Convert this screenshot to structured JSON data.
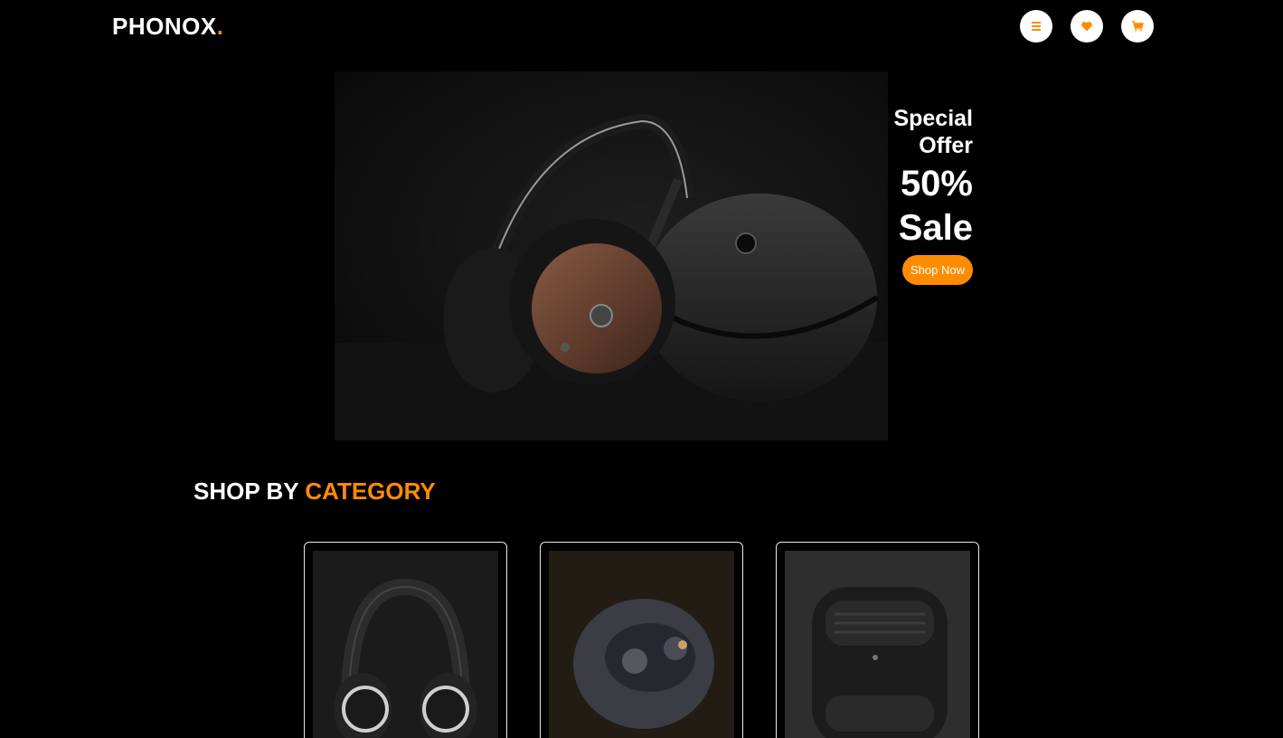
{
  "brand": {
    "name": "PHONOX",
    "dot": "."
  },
  "header": {
    "icons": [
      {
        "name": "menu-icon"
      },
      {
        "name": "heart-icon"
      },
      {
        "name": "cart-icon"
      }
    ]
  },
  "hero": {
    "offer_line1": "Special",
    "offer_line2": "Offer",
    "percent": "50%",
    "sale": "Sale",
    "cta": "Shop Now",
    "image_alt": "headphones"
  },
  "category_section": {
    "title_prefix": "SHOP BY",
    "title_accent": "CATEGORY",
    "cards": [
      {
        "image": "over-ear-headphones"
      },
      {
        "image": "wireless-earbuds"
      },
      {
        "image": "earbuds-case"
      }
    ]
  },
  "colors": {
    "accent": "#ff8c00",
    "background": "#000000",
    "text": "#ffffff"
  }
}
